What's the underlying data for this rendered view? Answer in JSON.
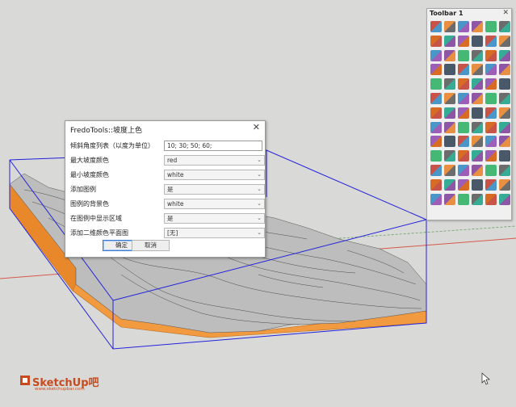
{
  "dialog": {
    "title": "FredoTools::坡度上色",
    "close_glyph": "✕",
    "rows": [
      {
        "label": "倾斜角度列表（以度为单位）",
        "value": "10; 30; 50; 60;",
        "kind": "text"
      },
      {
        "label": "最大坡度颜色",
        "value": "red",
        "kind": "select"
      },
      {
        "label": "最小坡度颜色",
        "value": "white",
        "kind": "select"
      },
      {
        "label": "添加图例",
        "value": "是",
        "kind": "select"
      },
      {
        "label": "图例的背景色",
        "value": "white",
        "kind": "select"
      },
      {
        "label": "在图例中显示区域",
        "value": "是",
        "kind": "select"
      },
      {
        "label": "添加二维颜色平面图",
        "value": "[无]",
        "kind": "select"
      }
    ],
    "ok_label": "确定",
    "cancel_label": "取消"
  },
  "toolbar": {
    "title": "Toolbar 1",
    "close_glyph": "✕",
    "tool_count": 78,
    "tool_colors": [
      "#c0392b",
      "#e67e22",
      "#2e86c1",
      "#7d3c98",
      "#27ae60",
      "#555555",
      "#d35400",
      "#16a085",
      "#8e44ad",
      "#2c3e50"
    ]
  },
  "logo": {
    "name": "SketchUp吧",
    "url": "www.sketchupbar.com"
  },
  "colors": {
    "bbox": "#2222dd",
    "terrain": "#b9b9b9",
    "base": "#f29a3f",
    "axis_red": "#d65a4a"
  }
}
